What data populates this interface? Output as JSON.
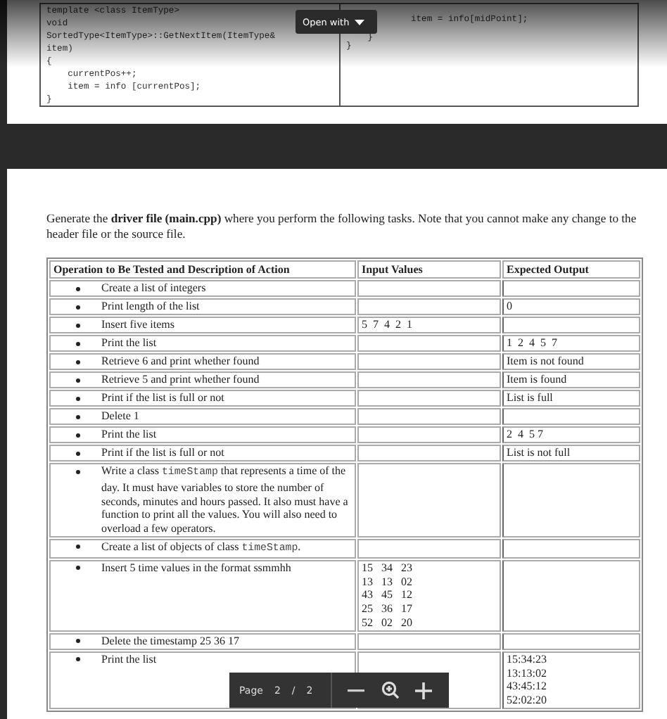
{
  "viewer": {
    "open_with": "Open with"
  },
  "page_1": {
    "code_left": [
      "template <class ItemType>",
      "void",
      "SortedType<ItemType>::GetNextItem(ItemType&",
      "item)",
      "{",
      "    currentPos++;",
      "    item = info [currentPos];",
      "}"
    ],
    "code_right": [
      "item = info[midPoint];",
      "    }",
      "}"
    ]
  },
  "page_2": {
    "intro": "Generate the **driver file (main.cpp)** where you perform the following tasks. Note that you cannot make any change to the header file or the source file.",
    "table": {
      "columns": [
        "Operation to Be Tested and Description of Action",
        "Input Values",
        "Expected Output"
      ],
      "rows": [
        {
          "operation": [
            {
              "kind": "text",
              "text": "Create a list of integers"
            }
          ],
          "input": [],
          "output": []
        },
        {
          "operation": [
            {
              "kind": "text",
              "text": "Print length of the list"
            }
          ],
          "input": [],
          "output": [
            "0"
          ]
        },
        {
          "operation": [
            {
              "kind": "text",
              "text": "Insert five items"
            }
          ],
          "input": [
            "5  7  4  2  1"
          ],
          "output": []
        },
        {
          "operation": [
            {
              "kind": "text",
              "text": "Print the list"
            }
          ],
          "input": [],
          "output": [
            "1  2  4  5  7"
          ]
        },
        {
          "operation": [
            {
              "kind": "text",
              "text": "Retrieve 6 and print whether found"
            }
          ],
          "input": [],
          "output": [
            "Item is not found"
          ]
        },
        {
          "operation": [
            {
              "kind": "text",
              "text": "Retrieve 5 and print whether found"
            }
          ],
          "input": [],
          "output": [
            "Item is found"
          ]
        },
        {
          "operation": [
            {
              "kind": "text",
              "text": "Print if the list is full or not"
            }
          ],
          "input": [],
          "output": [
            "List is full"
          ]
        },
        {
          "operation": [
            {
              "kind": "text",
              "text": "Delete 1"
            }
          ],
          "input": [],
          "output": []
        },
        {
          "operation": [
            {
              "kind": "text",
              "text": "Print the list"
            }
          ],
          "input": [],
          "output": [
            "2  4  5 7"
          ]
        },
        {
          "operation": [
            {
              "kind": "text",
              "text": "Print if the list is full or not"
            }
          ],
          "input": [],
          "output": [
            "List is not full"
          ]
        },
        {
          "operation": [
            {
              "kind": "text",
              "text": "Write a class "
            },
            {
              "kind": "code",
              "text": "timeStamp"
            },
            {
              "kind": "text",
              "text": " that represents a time of the day. It must have variables to store the number of seconds, minutes and hours passed. It also must have a function to print all the values. You will also need to overload a few operators."
            }
          ],
          "input": [],
          "output": []
        },
        {
          "operation": [
            {
              "kind": "text",
              "text": "Create a list of objects of class "
            },
            {
              "kind": "code",
              "text": "timeStamp"
            },
            {
              "kind": "text",
              "text": "."
            }
          ],
          "input": [],
          "output": []
        },
        {
          "operation": [
            {
              "kind": "text",
              "text": "Insert 5 time values in the format ssmmhh"
            }
          ],
          "input": [
            "15   34   23",
            "13   13   02",
            "43   45   12",
            "25   36   17",
            "52   02   20"
          ],
          "output": []
        },
        {
          "operation": [
            {
              "kind": "text",
              "text": "Delete the timestamp 25   36   17"
            }
          ],
          "input": [],
          "output": []
        },
        {
          "operation": [
            {
              "kind": "text",
              "text": "Print the list"
            }
          ],
          "input": [],
          "output": [
            "15:34:23",
            "13:13:02",
            "43:45:12",
            "52:02:20"
          ]
        }
      ]
    }
  },
  "page_nav": {
    "label": "Page",
    "current": "2",
    "separator": "/",
    "total": "2"
  }
}
